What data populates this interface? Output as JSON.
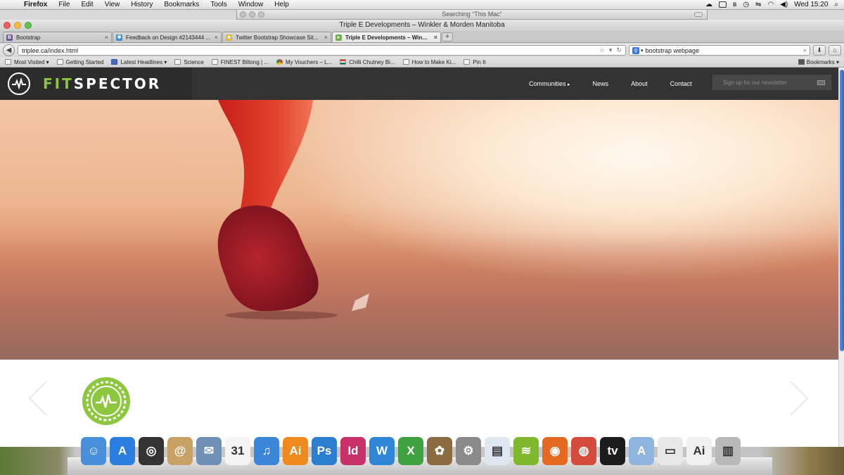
{
  "menubar": {
    "app": "Firefox",
    "items": [
      "File",
      "Edit",
      "View",
      "History",
      "Bookmarks",
      "Tools",
      "Window",
      "Help"
    ],
    "clock": "Wed 15:20"
  },
  "spotlight": {
    "title": "Searching “This Mac”"
  },
  "window": {
    "title": "Triple E Developments – Winkler & Morden Manitoba"
  },
  "tabs": [
    {
      "label": "Bootstrap",
      "icon": "bootstrap-favicon",
      "color": "#6f5499",
      "glyph": "B"
    },
    {
      "label": "Feedback on Design #2143444 ...",
      "icon": "feedback-favicon",
      "color": "#3a8ed6",
      "glyph": "✱"
    },
    {
      "label": "Twitter Bootstrap Showcase Sit...",
      "icon": "star-favicon",
      "color": "#e0b640",
      "glyph": "★"
    },
    {
      "label": "Triple E Developments – Winkle...",
      "icon": "play-favicon",
      "color": "#6cb33f",
      "glyph": "▸",
      "active": true
    }
  ],
  "navbar": {
    "url": "triplee.ca/index.html",
    "search_value": "bootstrap webpage"
  },
  "bookmarks": {
    "items": [
      {
        "label": "Most Visited ▾",
        "kind": "plain"
      },
      {
        "label": "Getting Started",
        "kind": "plain"
      },
      {
        "label": "Latest Headlines ▾",
        "kind": "rss"
      },
      {
        "label": "Science",
        "kind": "plain"
      },
      {
        "label": "FINEST Biltong | ...",
        "kind": "plain"
      },
      {
        "label": "My Vouchers – L...",
        "kind": "chrome"
      },
      {
        "label": "Chilli Chutney Bi...",
        "kind": "flag"
      },
      {
        "label": "How to Make Ki...",
        "kind": "plain"
      },
      {
        "label": "Pin It",
        "kind": "plain"
      }
    ],
    "right_label": "Bookmarks ▾"
  },
  "site": {
    "brand_fit": "FIT",
    "brand_spector": "SPECTOR",
    "nav": [
      "Communities",
      "News",
      "About",
      "Contact"
    ],
    "newsletter_placeholder": "Sign up for our newsletter",
    "accent": "#8dc63f"
  },
  "dock": {
    "apps": [
      {
        "name": "finder",
        "color": "#4a8fd9",
        "glyph": "☺"
      },
      {
        "name": "app-store",
        "color": "#2a7ee0",
        "glyph": "A"
      },
      {
        "name": "dashboard",
        "color": "#333333",
        "glyph": "◎"
      },
      {
        "name": "contacts",
        "color": "#c9a066",
        "glyph": "@"
      },
      {
        "name": "mail-bird",
        "color": "#6f8fb5",
        "glyph": "✉"
      },
      {
        "name": "calendar",
        "color": "#f4f4f4",
        "glyph": "31"
      },
      {
        "name": "itunes",
        "color": "#3b86d8",
        "glyph": "♫"
      },
      {
        "name": "illustrator",
        "color": "#ef8a1f",
        "glyph": "Ai"
      },
      {
        "name": "photoshop",
        "color": "#2c7fd0",
        "glyph": "Ps"
      },
      {
        "name": "indesign",
        "color": "#c8306a",
        "glyph": "Id"
      },
      {
        "name": "word",
        "color": "#2f86d6",
        "glyph": "W"
      },
      {
        "name": "excel",
        "color": "#3fa13f",
        "glyph": "X"
      },
      {
        "name": "iphoto",
        "color": "#8b6b42",
        "glyph": "✿"
      },
      {
        "name": "system-preferences",
        "color": "#8a8a8a",
        "glyph": "⚙"
      },
      {
        "name": "preview",
        "color": "#dfe8f1",
        "glyph": "▤"
      },
      {
        "name": "spotify",
        "color": "#7fb82d",
        "glyph": "≋"
      },
      {
        "name": "firefox",
        "color": "#e46a22",
        "glyph": "◉"
      },
      {
        "name": "photo-booth",
        "color": "#d44b3c",
        "glyph": "◍"
      },
      {
        "name": "apple-tv",
        "color": "#1c1c1c",
        "glyph": "tv"
      },
      {
        "name": "applications-folder",
        "color": "#8fb4de",
        "glyph": "A"
      },
      {
        "name": "documents-stack",
        "color": "#e8e8e8",
        "glyph": "▭"
      },
      {
        "name": "downloads-stack",
        "color": "#f0f0f0",
        "glyph": "Ai"
      },
      {
        "name": "trash",
        "color": "#b9b9b9",
        "glyph": "▥"
      }
    ]
  }
}
